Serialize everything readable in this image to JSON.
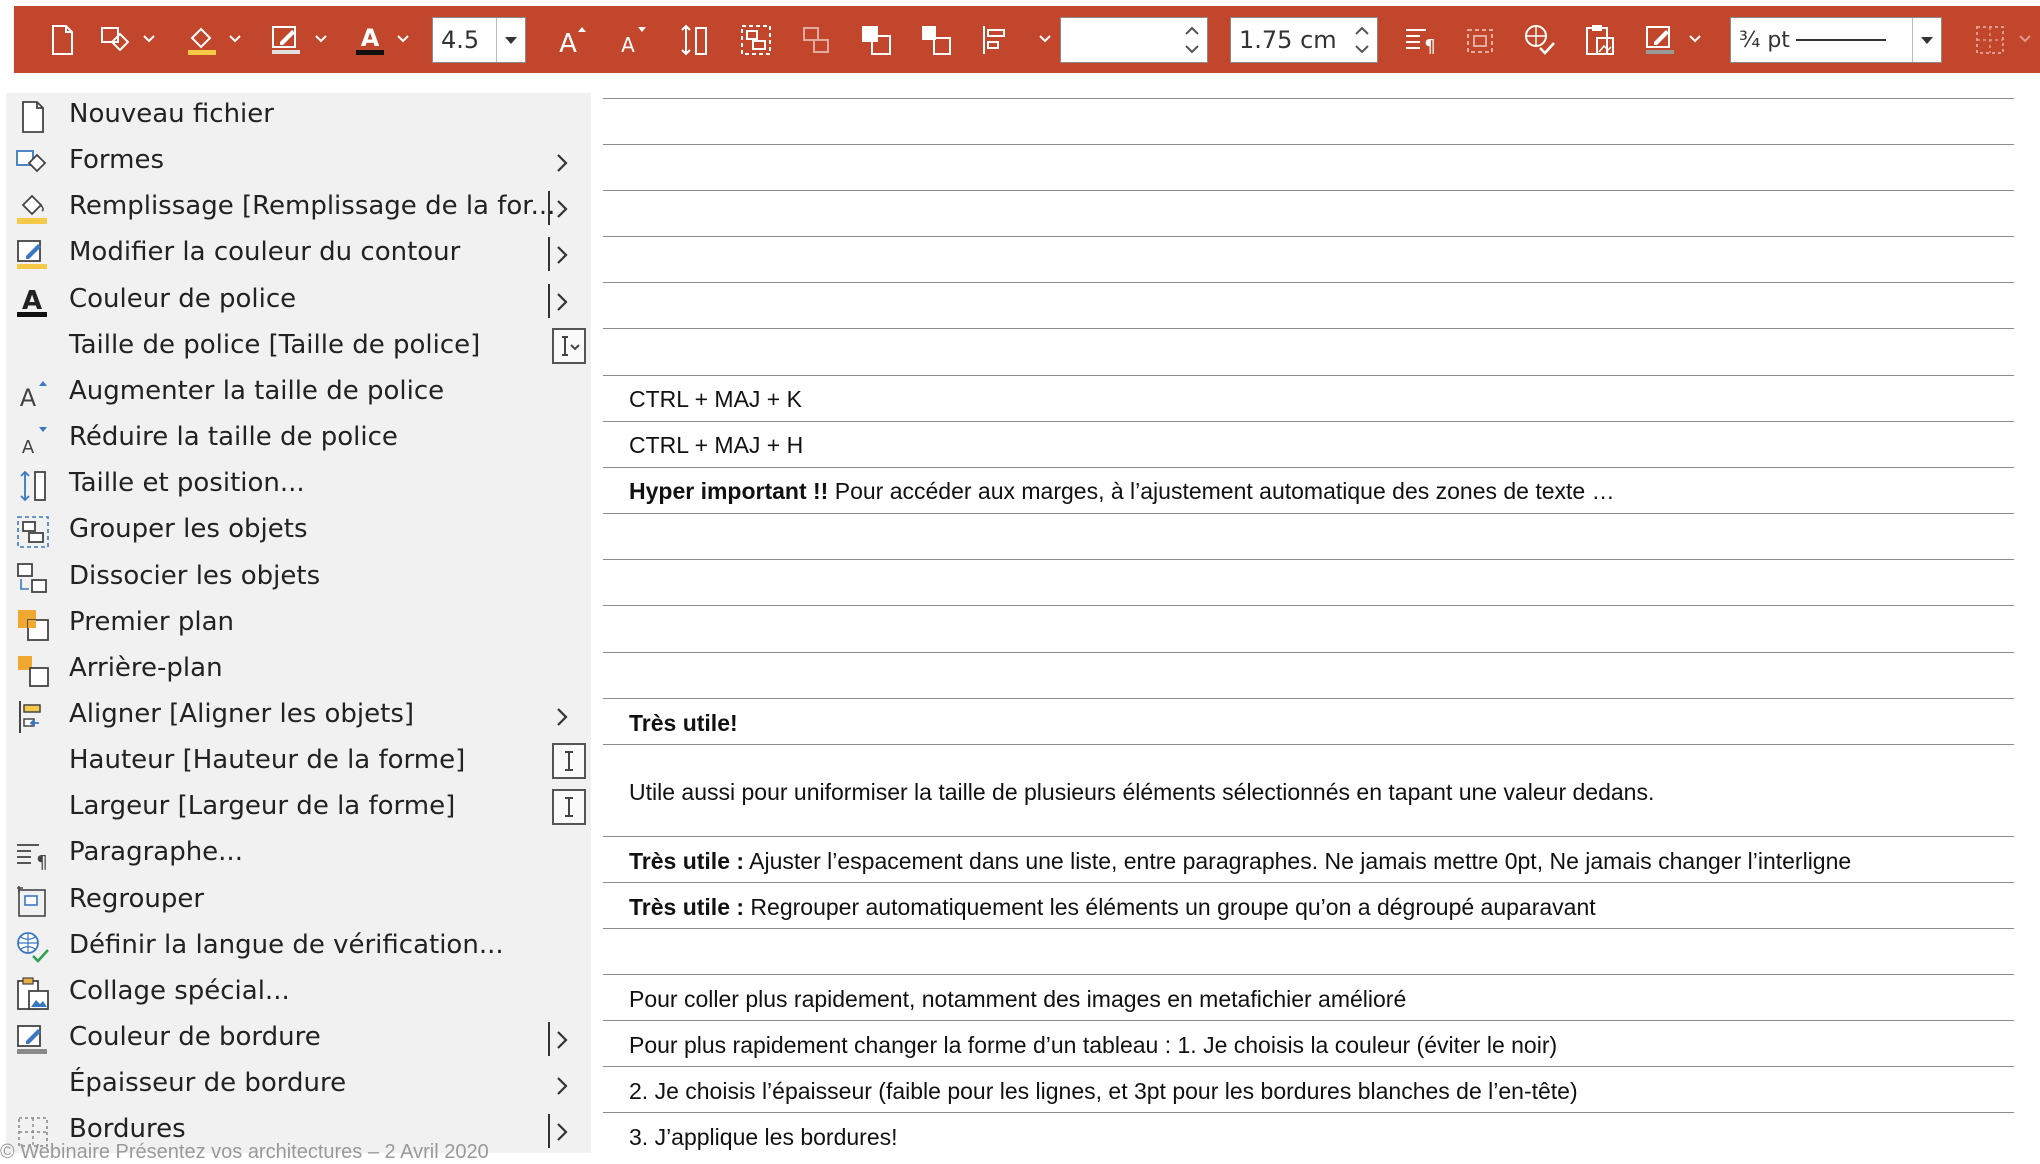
{
  "toolbar": {
    "font_size_value": "4.5",
    "height_value": "",
    "width_value": "1.75 cm",
    "border_weight_value": "¾ pt",
    "icons": [
      "new-file-icon",
      "shapes-icon",
      "fill-icon",
      "outline-icon",
      "font-color-icon",
      "increase-font-icon",
      "decrease-font-icon",
      "size-position-icon",
      "group-icon",
      "ungroup-icon",
      "bring-front-icon",
      "send-back-icon",
      "align-icon",
      "paragraph-icon",
      "regroup-icon",
      "language-icon",
      "paste-special-icon",
      "border-color-icon",
      "borders-icon"
    ],
    "colors": {
      "bar": "#c1462b",
      "fill_accent": "#f7c948",
      "outline_accent": "#4a90c8"
    }
  },
  "menu": {
    "items": [
      {
        "label": "Nouveau fichier",
        "icon": "new-file-icon",
        "suffix": "none"
      },
      {
        "label": "Formes",
        "icon": "shapes-icon",
        "suffix": "arrow"
      },
      {
        "label": "Remplissage [Remplissage de la for...",
        "icon": "fill-icon",
        "suffix": "split-arrow"
      },
      {
        "label": "Modifier la couleur du contour",
        "icon": "outline-color-icon",
        "suffix": "split-arrow"
      },
      {
        "label": "Couleur de police",
        "icon": "font-color-icon",
        "suffix": "split-arrow"
      },
      {
        "label": "Taille de police  [Taille de police]",
        "icon": "none",
        "suffix": "box-dropdown"
      },
      {
        "label": "Augmenter la taille de police",
        "icon": "increase-font-icon",
        "suffix": "none"
      },
      {
        "label": "Réduire la taille de police",
        "icon": "decrease-font-icon",
        "suffix": "none"
      },
      {
        "label": "Taille et position...",
        "icon": "size-position-icon",
        "suffix": "none"
      },
      {
        "label": "Grouper les objets",
        "icon": "group-icon",
        "suffix": "none"
      },
      {
        "label": "Dissocier les objets",
        "icon": "ungroup-icon",
        "suffix": "none"
      },
      {
        "label": "Premier plan",
        "icon": "bring-front-icon",
        "suffix": "none"
      },
      {
        "label": "Arrière-plan",
        "icon": "send-back-icon",
        "suffix": "none"
      },
      {
        "label": "Aligner [Aligner les objets]",
        "icon": "align-icon",
        "suffix": "arrow"
      },
      {
        "label": "Hauteur  [Hauteur de la forme]",
        "icon": "none",
        "suffix": "box-text"
      },
      {
        "label": "Largeur  [Largeur de la forme]",
        "icon": "none",
        "suffix": "box-text"
      },
      {
        "label": "Paragraphe...",
        "icon": "paragraph-icon",
        "suffix": "none"
      },
      {
        "label": "Regrouper",
        "icon": "regroup-icon",
        "suffix": "none"
      },
      {
        "label": "Définir la langue de vérification...",
        "icon": "language-icon",
        "suffix": "none"
      },
      {
        "label": "Collage spécial...",
        "icon": "paste-special-icon",
        "suffix": "none"
      },
      {
        "label": "Couleur de bordure",
        "icon": "border-color-icon",
        "suffix": "split-arrow"
      },
      {
        "label": "Épaisseur de bordure",
        "icon": "none",
        "suffix": "arrow"
      },
      {
        "label": "Bordures",
        "icon": "borders-icon",
        "suffix": "split-arrow"
      }
    ],
    "footer_text": "© Webinaire Présentez vos architectures – 2 Avril 2020"
  },
  "notes": {
    "rows": [
      {
        "bold": "",
        "text": ""
      },
      {
        "bold": "",
        "text": ""
      },
      {
        "bold": "",
        "text": ""
      },
      {
        "bold": "",
        "text": ""
      },
      {
        "bold": "",
        "text": ""
      },
      {
        "bold": "",
        "text": ""
      },
      {
        "bold": "",
        "text": "CTRL + MAJ + K"
      },
      {
        "bold": "",
        "text": "CTRL + MAJ + H"
      },
      {
        "bold": "Hyper important !!",
        "text": " Pour accéder aux marges, à l’ajustement automatique des zones de texte …"
      },
      {
        "bold": "",
        "text": ""
      },
      {
        "bold": "",
        "text": ""
      },
      {
        "bold": "",
        "text": ""
      },
      {
        "bold": "",
        "text": ""
      },
      {
        "bold": "Très utile!",
        "text": ""
      },
      {
        "bold": "",
        "text": "Utile aussi pour uniformiser la taille de plusieurs éléments sélectionnés en tapant une valeur dedans."
      },
      {
        "bold": "Très utile :",
        "text": " Ajuster l’espacement dans une liste, entre paragraphes. Ne jamais mettre 0pt, Ne jamais changer l’interligne"
      },
      {
        "bold": "Très utile :",
        "text": " Regrouper automatiquement les éléments un groupe qu’on a dégroupé auparavant"
      },
      {
        "bold": "",
        "text": ""
      },
      {
        "bold": "",
        "text": "Pour coller plus rapidement, notamment des images en metafichier amélioré"
      },
      {
        "bold": "",
        "text": "Pour plus rapidement changer la forme d’un tableau : 1. Je choisis la couleur (éviter le noir)"
      },
      {
        "bold": "",
        "text": "2. Je choisis l’épaisseur (faible pour les lignes, et 3pt pour les bordures blanches de l’en-tête)"
      },
      {
        "bold": "",
        "text": "3. J’applique les bordures!"
      }
    ]
  }
}
